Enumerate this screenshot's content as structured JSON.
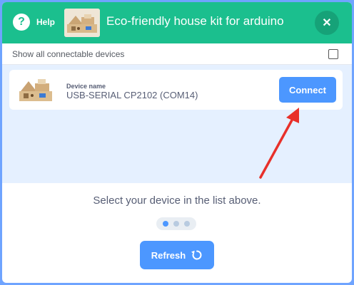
{
  "header": {
    "help_label": "Help",
    "title": "Eco-friendly house kit for arduino",
    "help_icon_glyph": "?",
    "close_icon_glyph": "✕"
  },
  "options": {
    "show_all_label": "Show all connectable devices",
    "show_all_checked": false
  },
  "device": {
    "caption": "Device name",
    "name": "USB-SERIAL CP2102 (COM14)",
    "connect_label": "Connect"
  },
  "footer": {
    "prompt": "Select your device in the list above.",
    "refresh_label": "Refresh",
    "step_dots": [
      {
        "color": "#4c97ff"
      },
      {
        "color": "#b8cbe0"
      },
      {
        "color": "#b8cbe0"
      }
    ]
  },
  "colors": {
    "header_bg": "#1bbf8e",
    "button_bg": "#4c97ff",
    "list_bg": "#e5f0ff",
    "annotation_arrow": "#e8302a",
    "frame": "#6fa4ff"
  }
}
